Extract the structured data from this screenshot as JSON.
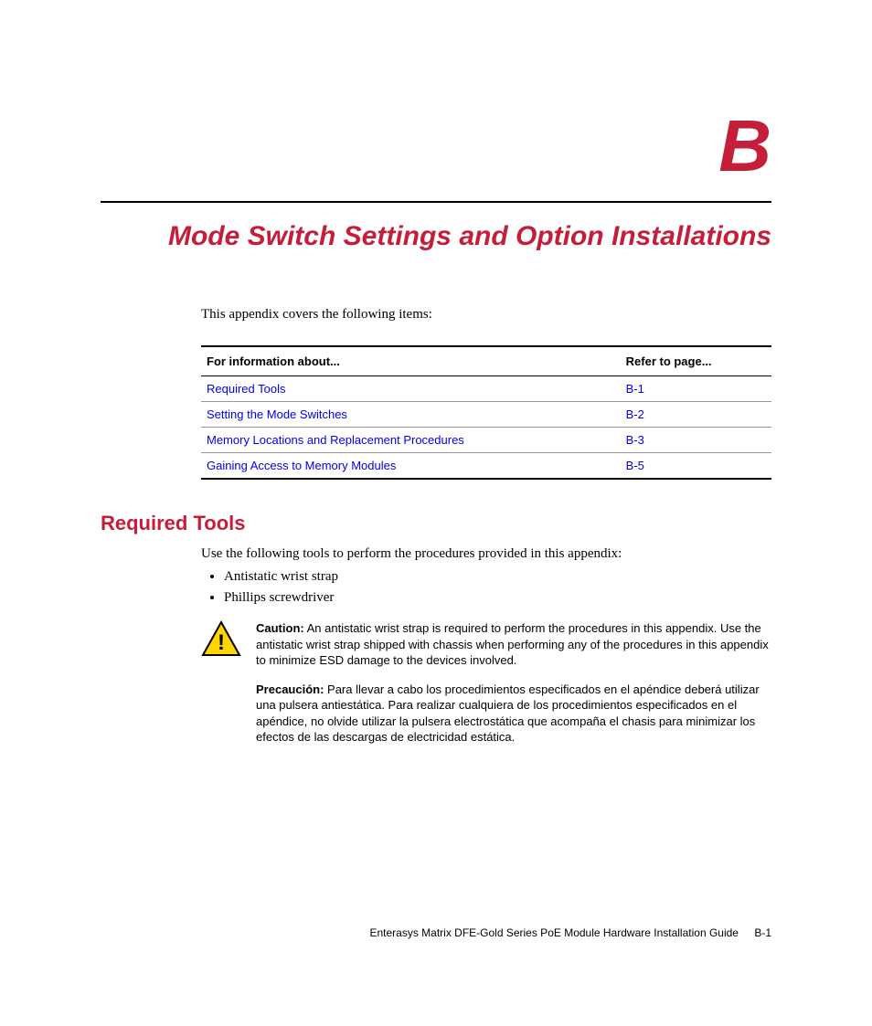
{
  "appendix_letter": "B",
  "chapter_title": "Mode Switch Settings and Option Installations",
  "intro_text": "This appendix covers the following items:",
  "table": {
    "header_info": "For information about...",
    "header_page": "Refer to page...",
    "rows": [
      {
        "topic": "Required Tools",
        "page": "B-1"
      },
      {
        "topic": "Setting the Mode Switches",
        "page": "B-2"
      },
      {
        "topic": "Memory Locations and Replacement Procedures",
        "page": "B-3"
      },
      {
        "topic": "Gaining Access to Memory Modules",
        "page": "B-5"
      }
    ]
  },
  "section1": {
    "heading": "Required Tools",
    "intro": "Use the following tools to perform the procedures provided in this appendix:",
    "bullets": [
      "Antistatic wrist strap",
      "Phillips screwdriver"
    ],
    "caution_label": "Caution:",
    "caution_en": " An antistatic wrist strap is required to perform the procedures in this appendix. Use the antistatic wrist strap shipped with chassis when performing any of the procedures in this appendix to minimize ESD damage to the devices involved.",
    "precaucion_label": "Precaución:",
    "caution_es": " Para llevar a cabo los procedimientos especificados en el apéndice deberá utilizar una pulsera antiestática. Para realizar cualquiera de los procedimientos especificados en el apéndice, no olvide utilizar la pulsera electrostática que acompaña el chasis para minimizar los efectos de las descargas de electricidad estática."
  },
  "footer": {
    "doc_title": "Enterasys Matrix DFE-Gold Series PoE Module Hardware Installation Guide",
    "page_num": "B-1"
  }
}
